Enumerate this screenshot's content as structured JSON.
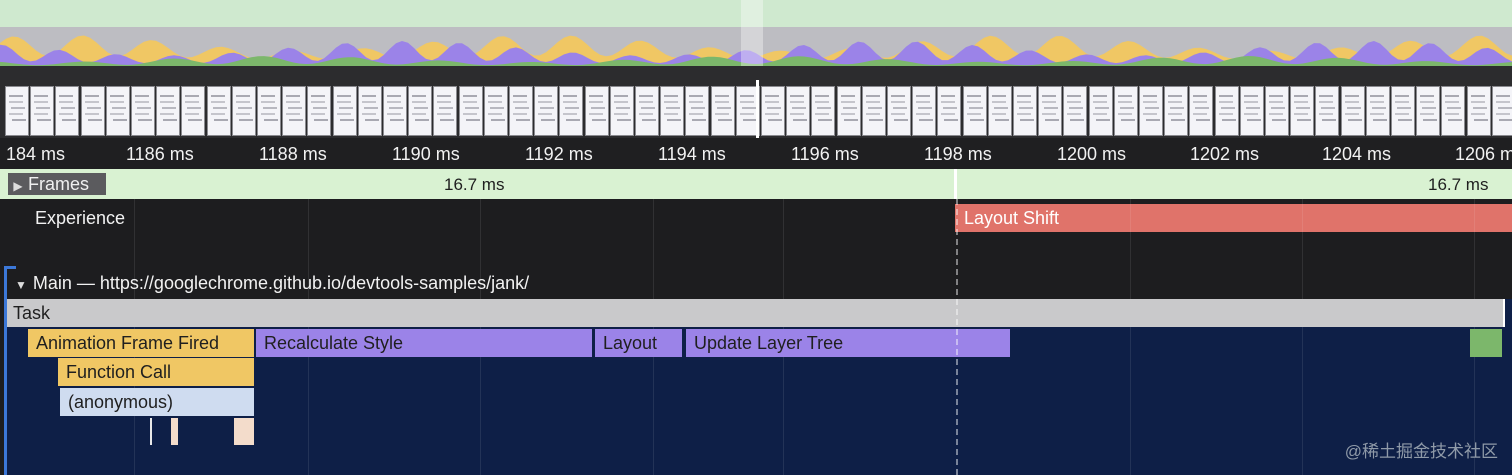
{
  "ruler": {
    "ticks": [
      "184 ms",
      "1186 ms",
      "1188 ms",
      "1190 ms",
      "1192 ms",
      "1194 ms",
      "1196 ms",
      "1198 ms",
      "1200 ms",
      "1202 ms",
      "1204 ms",
      "1206 ms"
    ]
  },
  "frames": {
    "label": "Frames",
    "durations": [
      "16.7 ms",
      "16.7 ms"
    ]
  },
  "experience": {
    "label": "Experience",
    "event": "Layout Shift"
  },
  "main": {
    "title": "Main — https://googlechrome.github.io/devtools-samples/jank/",
    "slices": {
      "task": "Task",
      "animation_frame_fired": "Animation Frame Fired",
      "recalculate_style": "Recalculate Style",
      "layout": "Layout",
      "update_layer_tree": "Update Layer Tree",
      "function_call": "Function Call",
      "anonymous": "(anonymous)"
    }
  },
  "colors": {
    "scripting": "#f0c764",
    "rendering": "#9b83e8",
    "painting": "#7cb76b",
    "layout_shift": "#e0736a",
    "frames": "#d9f2d2"
  },
  "watermark": "@稀土掘金技术社区"
}
